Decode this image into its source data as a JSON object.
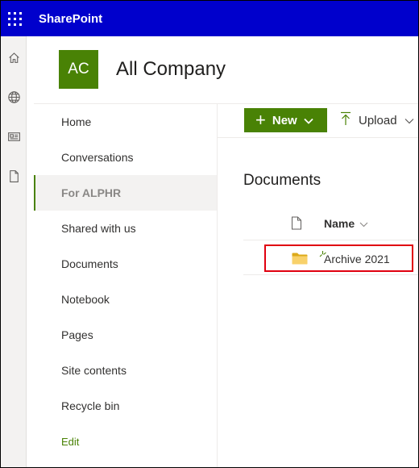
{
  "suite": {
    "app_name": "SharePoint"
  },
  "site": {
    "logo_initials": "AC",
    "title": "All Company",
    "accent_color": "#498205"
  },
  "app_bar": {
    "icons": [
      "home-icon",
      "globe-icon",
      "news-icon",
      "document-icon"
    ]
  },
  "left_nav": {
    "items": [
      {
        "label": "Home"
      },
      {
        "label": "Conversations"
      },
      {
        "label": "For ALPHR",
        "selected": true
      },
      {
        "label": "Shared with us"
      },
      {
        "label": "Documents"
      },
      {
        "label": "Notebook"
      },
      {
        "label": "Pages"
      },
      {
        "label": "Site contents"
      },
      {
        "label": "Recycle bin"
      }
    ],
    "edit_label": "Edit"
  },
  "command_bar": {
    "new_label": "New",
    "upload_label": "Upload"
  },
  "library": {
    "title": "Documents",
    "columns": {
      "name": "Name"
    },
    "rows": [
      {
        "name": "Archive 2021",
        "type": "folder",
        "icon": "folder-icon"
      }
    ]
  },
  "annotation": {
    "highlight_color": "#e0000f"
  }
}
